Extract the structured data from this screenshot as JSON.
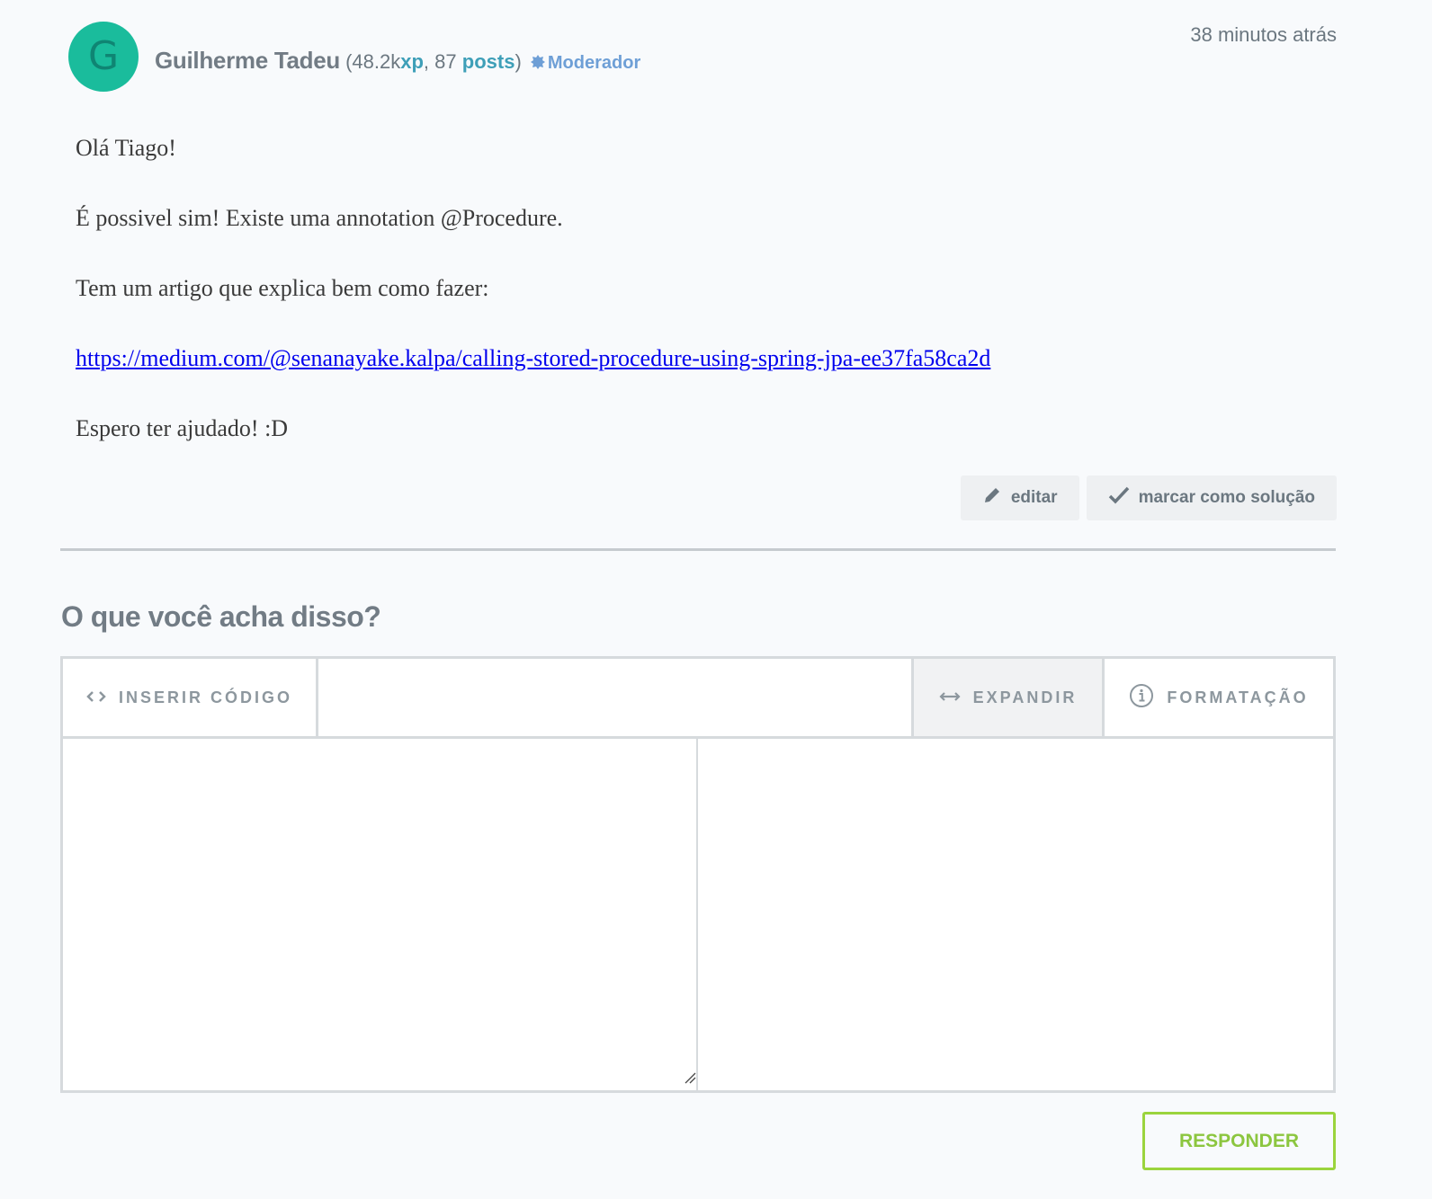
{
  "post": {
    "avatar_letter": "G",
    "author_name": "Guilherme Tadeu",
    "xp_value": "(48.2k",
    "xp_label": "xp",
    "sep": ", 87",
    "posts_label": "posts",
    "close_paren": ")",
    "role": "Moderador",
    "timestamp": "38 minutos atrás",
    "paragraphs": [
      "Olá Tiago!",
      "É possivel sim! Existe uma annotation @Procedure.",
      "Tem um artigo que explica bem como fazer:"
    ],
    "link": "https://medium.com/@senanayake.kalpa/calling-stored-procedure-using-spring-jpa-ee37fa58ca2d",
    "closing": "Espero ter ajudado! :D",
    "actions": {
      "edit_label": "editar",
      "solution_label": "marcar como solução"
    }
  },
  "reply": {
    "heading": "O que você acha disso?",
    "toolbar": {
      "code_label": "INSERIR CÓDIGO",
      "expand_label": "EXPANDIR",
      "format_label": "FORMATAÇÃO"
    },
    "submit_label": "RESPONDER"
  },
  "colors": {
    "avatar": "#1abc9c",
    "accent": "#3e9fb8",
    "moderator": "#6e9fd6",
    "submit": "#8cc63f"
  },
  "icons": [
    "pencil-icon",
    "check-icon",
    "code-icon",
    "expand-arrows-icon",
    "info-icon",
    "badge-icon",
    "resize-handle-icon"
  ]
}
